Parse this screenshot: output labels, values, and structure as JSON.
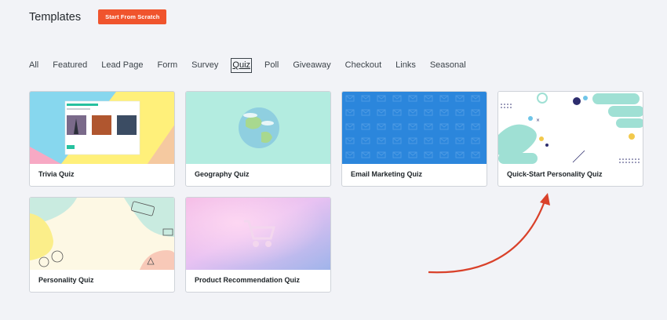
{
  "header": {
    "title": "Templates",
    "scratch_button": "Start From Scratch"
  },
  "filters": [
    {
      "label": "All",
      "active": false
    },
    {
      "label": "Featured",
      "active": false
    },
    {
      "label": "Lead Page",
      "active": false
    },
    {
      "label": "Form",
      "active": false
    },
    {
      "label": "Survey",
      "active": false
    },
    {
      "label": "Quiz",
      "active": true
    },
    {
      "label": "Poll",
      "active": false
    },
    {
      "label": "Giveaway",
      "active": false
    },
    {
      "label": "Checkout",
      "active": false
    },
    {
      "label": "Links",
      "active": false
    },
    {
      "label": "Seasonal",
      "active": false
    }
  ],
  "templates": [
    {
      "label": "Trivia Quiz",
      "thumb": "trivia"
    },
    {
      "label": "Geography Quiz",
      "thumb": "geography"
    },
    {
      "label": "Email Marketing Quiz",
      "thumb": "email"
    },
    {
      "label": "Quick-Start Personality Quiz",
      "thumb": "personality-quickstart"
    },
    {
      "label": "Personality Quiz",
      "thumb": "personality"
    },
    {
      "label": "Product Recommendation Quiz",
      "thumb": "product"
    }
  ],
  "colors": {
    "accent": "#f0542d",
    "arrow": "#d9412a",
    "email_blue": "#2b86dc",
    "teal": "#8fd9cb"
  },
  "icons": {
    "arrow": "curved-arrow-annotation",
    "cart": "shopping-cart-icon",
    "globe": "globe-icon"
  }
}
